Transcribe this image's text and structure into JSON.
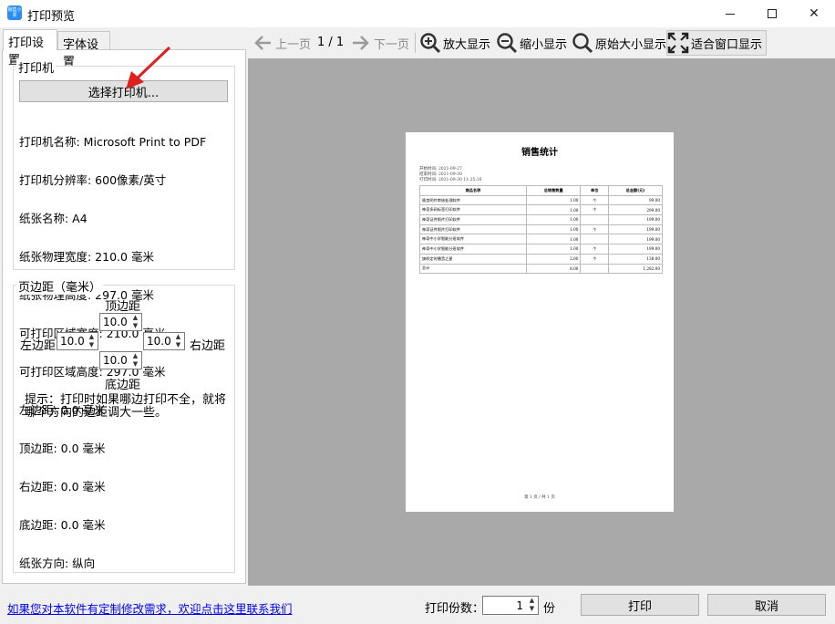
{
  "window": {
    "title": "打印预览",
    "app_icon_text": "销售小票"
  },
  "tabs": [
    {
      "label": "打印设置",
      "active": true
    },
    {
      "label": "字体设置",
      "active": false
    }
  ],
  "printer_group": {
    "label": "打印机",
    "select_button": "选择打印机...",
    "info": [
      "打印机名称: Microsoft Print to PDF",
      "打印机分辨率: 600像素/英寸",
      "纸张名称: A4",
      "纸张物理宽度: 210.0 毫米",
      "纸张物理高度: 297.0 毫米",
      "可打印区域宽度: 210.0 毫米",
      "可打印区域高度: 297.0 毫米",
      "左边距: 0.0 毫米",
      "顶边距: 0.0 毫米",
      "右边距: 0.0 毫米",
      "底边距: 0.0 毫米",
      "纸张方向: 纵向"
    ]
  },
  "margin_group": {
    "label": "页边距（毫米）",
    "top_label": "顶边距",
    "top_value": "10.0",
    "left_label": "左边距",
    "left_value": "10.0",
    "right_label": "右边距",
    "right_value": "10.0",
    "bottom_label": "底边距",
    "bottom_value": "10.0",
    "hint": "提示：打印时如果哪边打印不全，就将哪个方向的边距调大一些。"
  },
  "toolbar": {
    "prev": "上一页",
    "page_indicator": "1 / 1",
    "next": "下一页",
    "zoom_in": "放大显示",
    "zoom_out": "缩小显示",
    "original": "原始大小显示",
    "fit": "适合窗口显示"
  },
  "document": {
    "title": "销售统计",
    "meta": [
      "开始时间:  2021-09-27",
      "结束时间:  2021-09-30",
      "打印时间:  2021-09-30 11:25:16"
    ],
    "columns": [
      "商品名称",
      "总销售数量",
      "单位",
      "总金额(元)"
    ],
    "rows": [
      [
        "贩卖明片审核处理软件",
        "1.00",
        "个",
        "99.00"
      ],
      [
        "神奇多码标签打印软件",
        "1.00",
        "个",
        "299.00"
      ],
      [
        "神奇证件照片打印软件",
        "1.00",
        "",
        "199.00"
      ],
      [
        "神奇证件照片打印软件",
        "1.00",
        "个",
        "199.00"
      ],
      [
        "神奇中小学智能分班软件",
        "1.00",
        "",
        "199.00"
      ],
      [
        "神奇中小学智能分班软件",
        "1.00",
        "个",
        "199.00"
      ],
      [
        "旗帜定时播音之星",
        "2.00",
        "个",
        "138.00"
      ],
      [
        "总计",
        "8.00",
        "",
        "1,282.00"
      ]
    ],
    "footer": "第 1 页 / 共 1 页"
  },
  "bottom": {
    "link": "如果您对本软件有定制修改需求，欢迎点击这里联系我们",
    "copies_label": "打印份数：",
    "copies_value": "1",
    "copies_unit": "份",
    "print_button": "打印",
    "cancel_button": "取消"
  },
  "colors": {
    "preview_bg": "#a9a9a9",
    "link": "#0000ee",
    "arrow": "#e02020"
  }
}
